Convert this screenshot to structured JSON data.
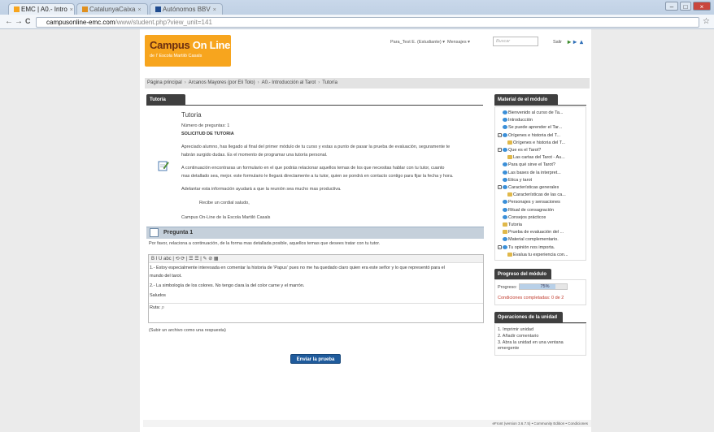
{
  "browser": {
    "tabs": [
      {
        "label": "EMC | A0.- Intro",
        "favicon": "emc-favicon",
        "close": "×"
      },
      {
        "label": "CatalunyaCaixa",
        "favicon": "catalunyacaixa-favicon",
        "close": "×"
      },
      {
        "label": "Autónomos BBV",
        "favicon": "bbva-favicon",
        "close": "×"
      }
    ],
    "url_host": "campusonline-emc.com",
    "url_path": "/www/student.php?view_unit=141",
    "nav": {
      "back": "←",
      "forward": "→",
      "reload": "C"
    },
    "window_buttons": {
      "minimize": "–",
      "maximize": "□",
      "close": "×"
    },
    "star": "☆"
  },
  "header": {
    "logo_line1_a": "Campus",
    "logo_line1_b": " On Line",
    "logo_line2": "de l' Escola Martiló Casals",
    "user": "Para_Test E. (Estudiante) ▾",
    "messages": "Mensajes ▾",
    "search_placeholder": "Buscar",
    "logout": "Salir"
  },
  "breadcrumb": [
    "Página principal",
    "Arcanos Mayores (por Eli Tolo)",
    "A0.- Introducción al Tarot",
    "Tutoría"
  ],
  "breadcrumb_sep": "›",
  "main": {
    "tab": "Tutoría",
    "title": "Tutoria",
    "num_questions": "Número de preguntas: 1",
    "request": "SOLICITUD DE TUTORIA",
    "p1a": "Apreciado alumno, has llegado al final del primer módulo de tu curso y estas a punto de pasar la prueba de evaluación, seguramente te",
    "p1b": "habrán surgido dudas. Es el momento de programar una tutoría personal.",
    "p2a": "A continuación encontraras un formulario en el que podrás relacionar aquellos temas de los que necesitas hablar con tu tutor, cuanto",
    "p2b": "mas detallado sea, mejor. este formulario le llegará directamente a tu tutor, quien se pondrá en contacto contigo para fijar la fecha y hora.",
    "p3": "Adelantar esta información ayudará a que la reunión sea mucho mas productiva.",
    "p4": "Recibe un cordial saludo,",
    "p5": "Campus On-Line de la Escola Martiló Casals",
    "question_title": "Pregunta 1",
    "question_text": "Por favor, relaciona a continuación, de la forma mas detallada posible, aquellos temas que desees tratar con tu tutor.",
    "editor_lines": [
      "1.- Estoy especialmente interesada en comentar la historia de 'Papus' pues no me ha quedado claro quien era este señor y lo que representó para el",
      "mundo del tarot.",
      "2.- La simbología de los colores. No tengo clara la del color carne y el marrón.",
      "Saludos"
    ],
    "editor_toolbar": "B  I  U  abc  |  ⟲  ⟳  |  ☰  ☰  |  ✎  ⊘  ▦",
    "path_label": "Ruta:",
    "path_value": "p",
    "upload_text": "(Subir un archivo como una respuesta)",
    "submit": "Enviar la prueba"
  },
  "sidebar": {
    "material_title": "Material de el módulo",
    "tree": [
      {
        "label": "Bienvenido al curso de Ta...",
        "level": 1,
        "icon": "globe"
      },
      {
        "label": "Introducción",
        "level": 1,
        "icon": "globe"
      },
      {
        "label": "Se puede aprender el Tar...",
        "level": 1,
        "icon": "globe"
      },
      {
        "label": "Orígenes e historia del T...",
        "level": 0,
        "icon": "globe",
        "expand": "−"
      },
      {
        "label": "Orígenes e historia del T...",
        "level": 2,
        "icon": "doc"
      },
      {
        "label": "Que es el Tarot?",
        "level": 0,
        "icon": "globe",
        "expand": "−"
      },
      {
        "label": "Las cartas del Tarot - Au...",
        "level": 2,
        "icon": "doc"
      },
      {
        "label": "Para qué sirve el Tarot?",
        "level": 1,
        "icon": "globe"
      },
      {
        "label": "Las bases de la interpret...",
        "level": 1,
        "icon": "globe"
      },
      {
        "label": "Ética y tarot",
        "level": 1,
        "icon": "globe"
      },
      {
        "label": "Características generales",
        "level": 0,
        "icon": "globe",
        "expand": "−"
      },
      {
        "label": "Características de las ca...",
        "level": 2,
        "icon": "doc"
      },
      {
        "label": "Personajes y sensaciones",
        "level": 1,
        "icon": "globe"
      },
      {
        "label": "Ritual de consagración",
        "level": 1,
        "icon": "globe"
      },
      {
        "label": "Consejos prácticos",
        "level": 1,
        "icon": "globe"
      },
      {
        "label": "Tutoria",
        "level": 1,
        "icon": "doc"
      },
      {
        "label": "Prueba de evaluación del ...",
        "level": 1,
        "icon": "doc"
      },
      {
        "label": "Material complementario.",
        "level": 1,
        "icon": "globe"
      },
      {
        "label": "Tu opinión nos importa.",
        "level": 0,
        "icon": "globe",
        "expand": "−"
      },
      {
        "label": "Evalua tu experiencia con...",
        "level": 2,
        "icon": "doc"
      }
    ],
    "progress_title": "Progreso del módulo",
    "progress_label": "Progreso:",
    "progress_value": "75%",
    "progress_fraction": 0.75,
    "progress_conditions": "Condiciones completadas: 0 de 2",
    "ops_title": "Operaciones de la unidad",
    "ops": [
      "1. Imprimir unidad",
      "2. Añadir comentario",
      "3. Abra la unidad en una ventana emergente"
    ]
  },
  "footer": "eFront (version 3.6.7.5) • Community Edition • Condiciones",
  "colors": {
    "accent": "#f7a51e",
    "dark": "#3f3f3f",
    "button": "#1f5b9c",
    "condition": "#c0392b"
  }
}
